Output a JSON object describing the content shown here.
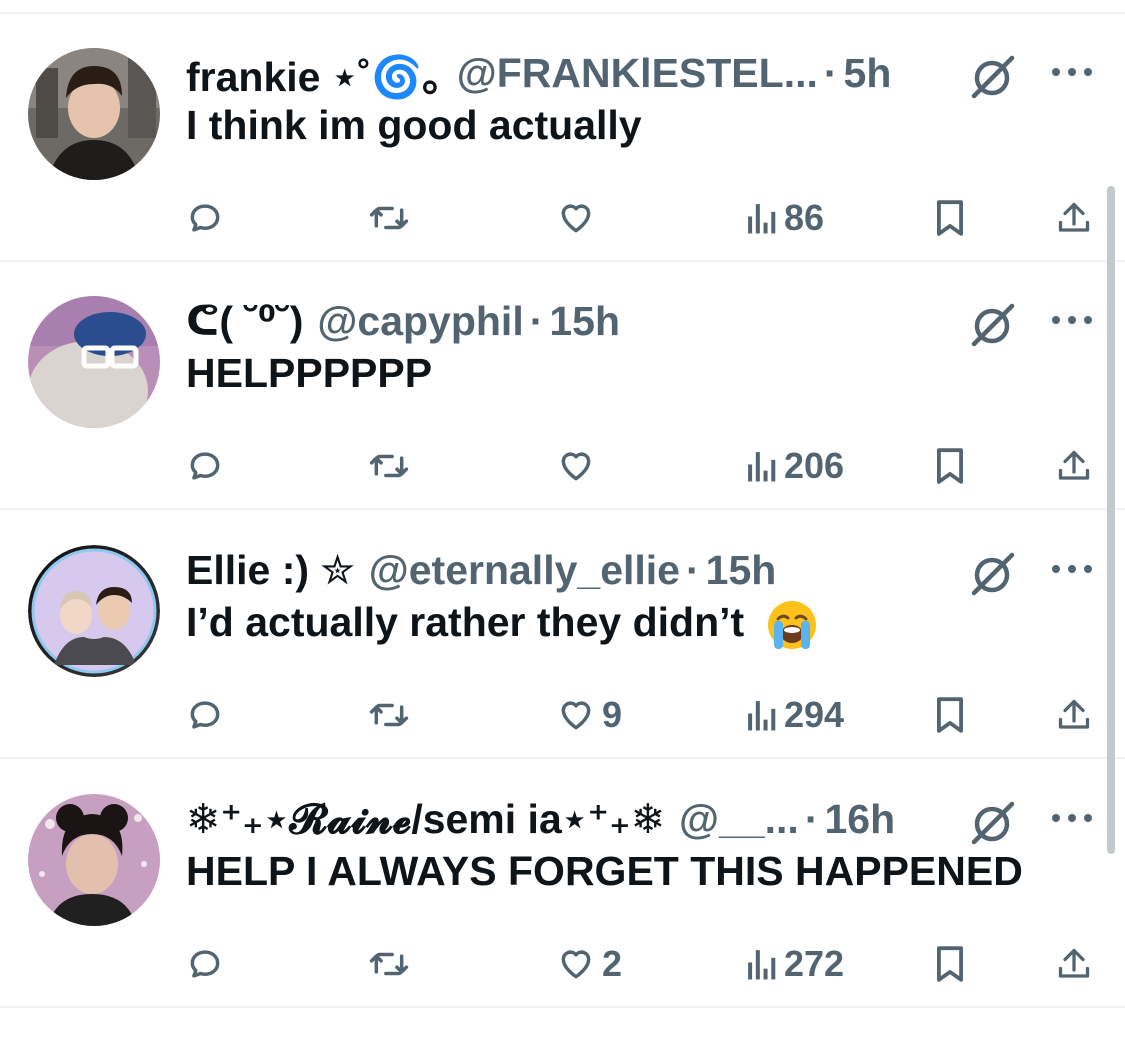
{
  "tweets": [
    {
      "name": "frankie ⋆˚🌀｡",
      "handle": "@FRANKlESTEL...",
      "time": "5h",
      "text": "I think im good actually",
      "likes": "",
      "views": "86",
      "avatar": "avatar-frankie"
    },
    {
      "name": "ᕦ( ˘⁰˘)",
      "handle": "@capyphil",
      "time": "15h",
      "text": "HELPPPPPP",
      "likes": "",
      "views": "206",
      "avatar": "avatar-capyphil"
    },
    {
      "name": "Ellie :) ✮",
      "handle": "@eternally_ellie",
      "time": "15h",
      "text": "I’d actually rather they didn’t",
      "emoji": "loudly-crying-face",
      "likes": "9",
      "views": "294",
      "avatar": "avatar-ellie"
    },
    {
      "name": "❄︎⁺₊⋆𝓡𝓪𝓲𝓷𝓮/semi ia⋆⁺₊❄︎",
      "handle": "@__...",
      "time": "16h",
      "text": "HELP I ALWAYS FORGET THIS HAPPENED",
      "likes": "2",
      "views": "272",
      "avatar": "avatar-raine"
    }
  ],
  "separator": "·",
  "colors": {
    "text": "#0f1419",
    "muted": "#536471",
    "divider": "#eff3f4"
  }
}
